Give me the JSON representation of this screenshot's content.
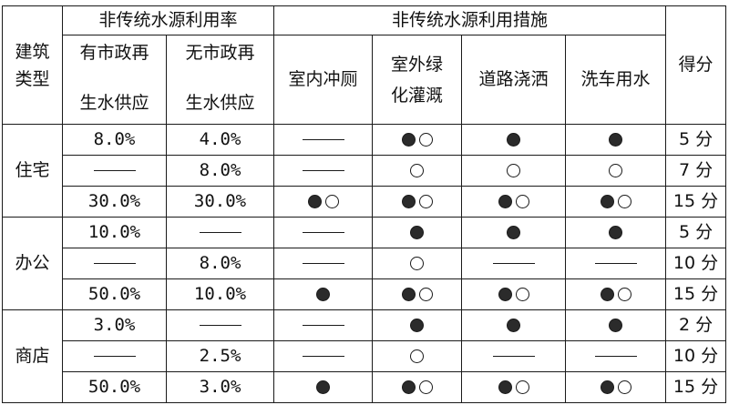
{
  "header": {
    "building_type": [
      "建筑",
      "类型"
    ],
    "usage_rate_group": "非传统水源利用率",
    "measures_group": "非传统水源利用措施",
    "score": "得分",
    "with_municipal": [
      "有市政再",
      "生水供应"
    ],
    "without_municipal": [
      "无市政再",
      "生水供应"
    ],
    "indoor_flush": "室内冲厕",
    "outdoor_green": [
      "室外绿",
      "化灌溉"
    ],
    "road_spray": "道路浇洒",
    "car_wash": "洗车用水"
  },
  "legend_icons": {
    "filled": "filled-circle",
    "open": "open-circle",
    "none": "dash"
  },
  "groups": [
    {
      "type": "住宅",
      "rows": [
        {
          "with_municipal": "8.0%",
          "without_municipal": "4.0%",
          "indoor_flush": "none",
          "outdoor_green": "filled+open",
          "road_spray": "filled",
          "car_wash": "filled",
          "score": "5 分"
        },
        {
          "with_municipal": "none",
          "without_municipal": "8.0%",
          "indoor_flush": "none",
          "outdoor_green": "open",
          "road_spray": "open",
          "car_wash": "open",
          "score": "7 分"
        },
        {
          "with_municipal": "30.0%",
          "without_municipal": "30.0%",
          "indoor_flush": "filled+open",
          "outdoor_green": "filled+open",
          "road_spray": "filled+open",
          "car_wash": "filled+open",
          "score": "15 分"
        }
      ]
    },
    {
      "type": "办公",
      "rows": [
        {
          "with_municipal": "10.0%",
          "without_municipal": "none",
          "indoor_flush": "none",
          "outdoor_green": "filled",
          "road_spray": "filled",
          "car_wash": "filled",
          "score": "5 分"
        },
        {
          "with_municipal": "none",
          "without_municipal": "8.0%",
          "indoor_flush": "none",
          "outdoor_green": "open",
          "road_spray": "none",
          "car_wash": "none",
          "score": "10 分"
        },
        {
          "with_municipal": "50.0%",
          "without_municipal": "10.0%",
          "indoor_flush": "filled",
          "outdoor_green": "filled+open",
          "road_spray": "filled+open",
          "car_wash": "filled+open",
          "score": "15 分"
        }
      ]
    },
    {
      "type": "商店",
      "rows": [
        {
          "with_municipal": "3.0%",
          "without_municipal": "none",
          "indoor_flush": "none",
          "outdoor_green": "filled",
          "road_spray": "filled",
          "car_wash": "filled",
          "score": "2 分"
        },
        {
          "with_municipal": "none",
          "without_municipal": "2.5%",
          "indoor_flush": "none",
          "outdoor_green": "open",
          "road_spray": "none",
          "car_wash": "none",
          "score": "10 分"
        },
        {
          "with_municipal": "50.0%",
          "without_municipal": "3.0%",
          "indoor_flush": "filled",
          "outdoor_green": "filled+open",
          "road_spray": "filled+open",
          "car_wash": "filled+open",
          "score": "15 分"
        }
      ]
    }
  ]
}
